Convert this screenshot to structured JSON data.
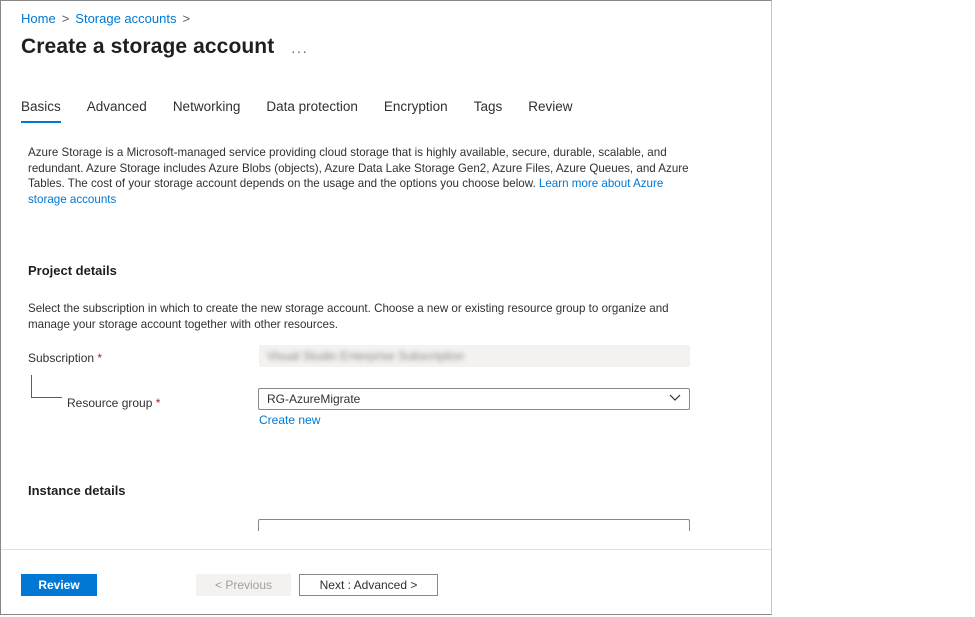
{
  "breadcrumb": {
    "home": "Home",
    "storage_accounts": "Storage accounts",
    "separator": ">"
  },
  "page": {
    "title": "Create a storage account",
    "more": "···"
  },
  "tabs": [
    {
      "label": "Basics",
      "active": true
    },
    {
      "label": "Advanced"
    },
    {
      "label": "Networking"
    },
    {
      "label": "Data protection"
    },
    {
      "label": "Encryption"
    },
    {
      "label": "Tags"
    },
    {
      "label": "Review"
    }
  ],
  "intro": {
    "text": "Azure Storage is a Microsoft-managed service providing cloud storage that is highly available, secure, durable, scalable, and redundant. Azure Storage includes Azure Blobs (objects), Azure Data Lake Storage Gen2, Azure Files, Azure Queues, and Azure Tables. The cost of your storage account depends on the usage and the options you choose below. ",
    "link": "Learn more about Azure storage accounts"
  },
  "project_details": {
    "title": "Project details",
    "description": "Select the subscription in which to create the new storage account. Choose a new or existing resource group to organize and manage your storage account together with other resources.",
    "subscription_label": "Subscription",
    "subscription_value": "Visual Studio Enterprise Subscription",
    "resource_group_label": "Resource group",
    "resource_group_value": "RG-AzureMigrate",
    "create_new": "Create new",
    "required_mark": "*"
  },
  "instance_details": {
    "title": "Instance details"
  },
  "footer": {
    "review": "Review",
    "previous": "< Previous",
    "next": "Next : Advanced >"
  }
}
